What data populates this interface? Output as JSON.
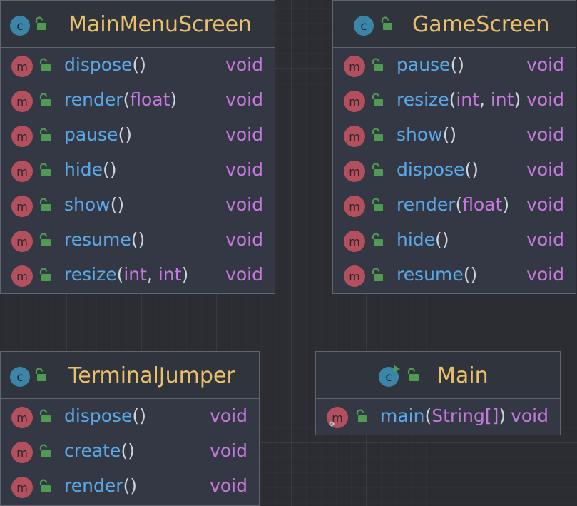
{
  "colors": {
    "background": "#2b2d33",
    "node_fill": "#333844",
    "node_border": "#5f646d",
    "class_name": "#e8bf6a",
    "method_name": "#5aa9e6",
    "param_type": "#c679dd",
    "return_type": "#c679dd",
    "class_icon": "#3b86a8",
    "method_icon": "#b4505e",
    "lock_icon": "#4f9b52"
  },
  "icons": {
    "class": "class-c-icon",
    "runnable_class": "runnable-class-icon",
    "method": "method-m-icon",
    "visibility": "public-lock-icon"
  },
  "classes": [
    {
      "name": "MainMenuScreen",
      "methods": [
        {
          "name": "dispose",
          "params": [],
          "return": "void"
        },
        {
          "name": "render",
          "params": [
            "float"
          ],
          "return": "void"
        },
        {
          "name": "pause",
          "params": [],
          "return": "void"
        },
        {
          "name": "hide",
          "params": [],
          "return": "void"
        },
        {
          "name": "show",
          "params": [],
          "return": "void"
        },
        {
          "name": "resume",
          "params": [],
          "return": "void"
        },
        {
          "name": "resize",
          "params": [
            "int",
            "int"
          ],
          "return": "void"
        }
      ]
    },
    {
      "name": "GameScreen",
      "methods": [
        {
          "name": "pause",
          "params": [],
          "return": "void"
        },
        {
          "name": "resize",
          "params": [
            "int",
            "int"
          ],
          "return": "void"
        },
        {
          "name": "show",
          "params": [],
          "return": "void"
        },
        {
          "name": "dispose",
          "params": [],
          "return": "void"
        },
        {
          "name": "render",
          "params": [
            "float"
          ],
          "return": "void"
        },
        {
          "name": "hide",
          "params": [],
          "return": "void"
        },
        {
          "name": "resume",
          "params": [],
          "return": "void"
        }
      ]
    },
    {
      "name": "TerminalJumper",
      "methods": [
        {
          "name": "dispose",
          "params": [],
          "return": "void"
        },
        {
          "name": "create",
          "params": [],
          "return": "void"
        },
        {
          "name": "render",
          "params": [],
          "return": "void"
        }
      ]
    },
    {
      "name": "Main",
      "runnable": true,
      "methods": [
        {
          "name": "main",
          "params": [
            "String[]"
          ],
          "return": "void",
          "static": true
        }
      ]
    }
  ]
}
